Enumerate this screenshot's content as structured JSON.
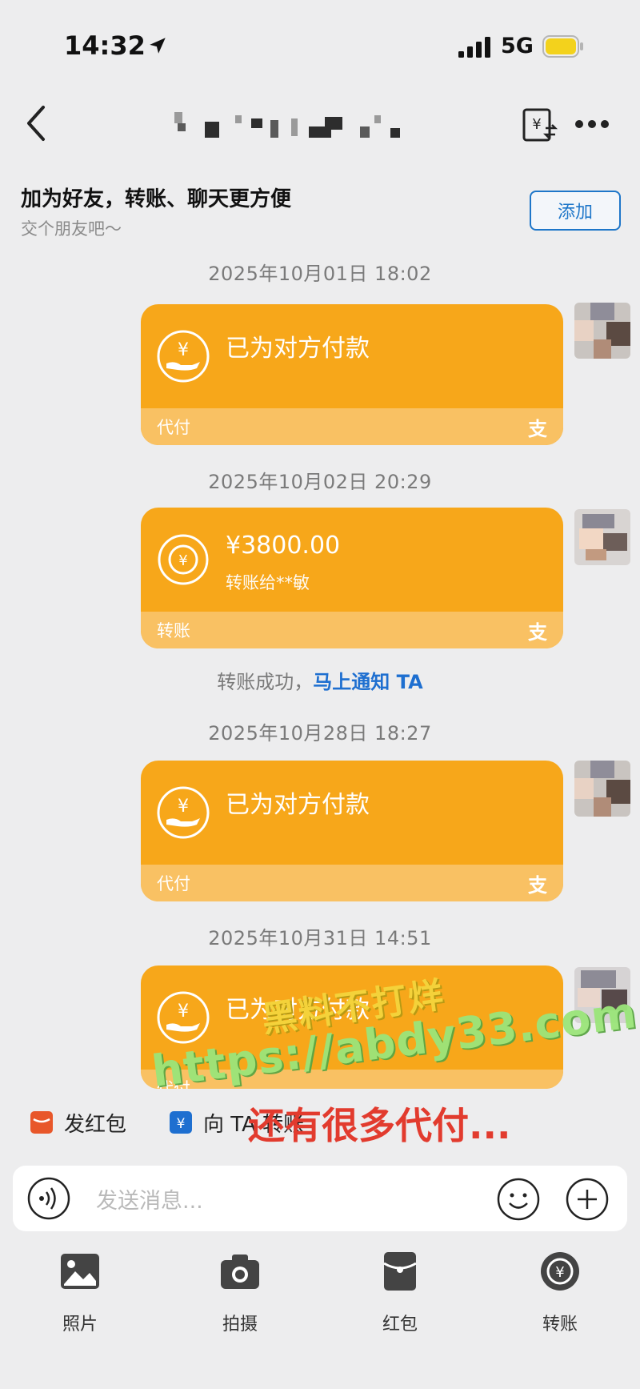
{
  "status_bar": {
    "time": "14:32",
    "network": "5G"
  },
  "nav": {
    "title": ""
  },
  "banner": {
    "title": "加为好友，转账、聊天更方便",
    "subtitle": "交个朋友吧～",
    "add_button": "添加"
  },
  "messages": [
    {
      "timestamp": "2025年10月01日 18:02",
      "card_text": "已为对方付款",
      "footer_label": "代付",
      "footer_logo": "支"
    },
    {
      "timestamp": "2025年10月02日 20:29",
      "amount": "¥3800.00",
      "note": "转账给**敏",
      "footer_label": "转账",
      "footer_logo": "支"
    },
    {
      "timestamp": "2025年10月28日 18:27",
      "card_text": "已为对方付款",
      "footer_label": "代付",
      "footer_logo": "支"
    },
    {
      "timestamp": "2025年10月31日 14:51",
      "card_text": "已为对方付款",
      "footer_label": "代付",
      "footer_logo": "支"
    }
  ],
  "transfer_notice": {
    "text": "转账成功，",
    "link": "马上通知 TA"
  },
  "watermarks": {
    "line1": "黑料不打烊",
    "line2": "https://abdy33.com",
    "caption": "还有很多代付..."
  },
  "quick_actions": {
    "red_packet": "发红包",
    "transfer_to": "向 TA 转账"
  },
  "input": {
    "placeholder": "发送消息..."
  },
  "tools": {
    "photo": "照片",
    "camera": "拍摄",
    "red_packet": "红包",
    "transfer": "转账"
  },
  "colors": {
    "card_orange": "#f7a71a",
    "card_footer": "#f9c163",
    "link_blue": "#1e6fd0",
    "add_blue": "#1e76c9"
  }
}
